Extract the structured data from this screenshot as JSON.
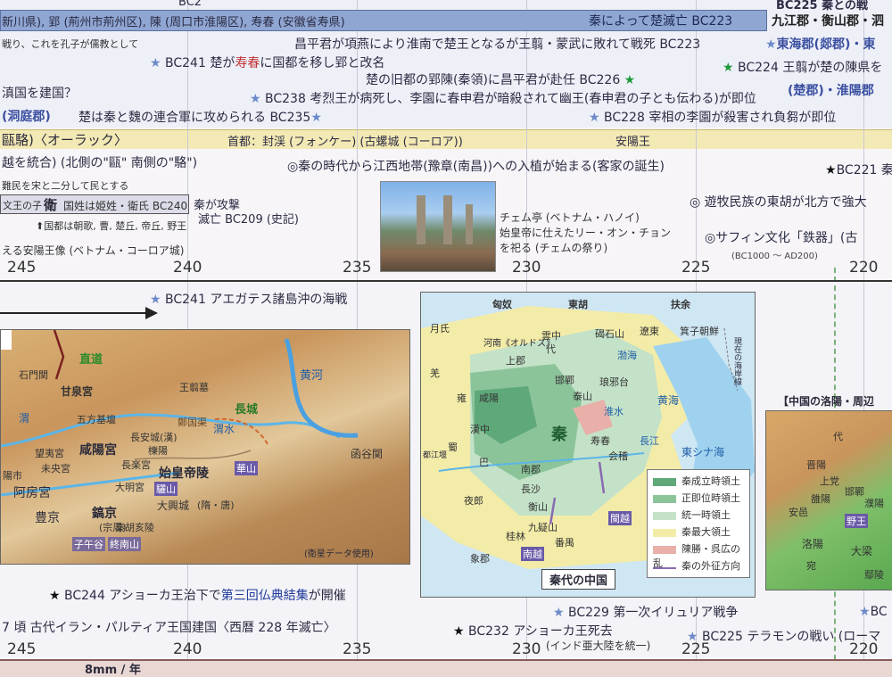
{
  "top": {
    "row0_left": "BC2",
    "row0_right": "BC225 秦との戦",
    "row1_left": "新川県), 郢 (荊州市荊州区), 陳 (周口市淮陽区), 寿春 (安徽省寿県)",
    "row1_bar": "秦によって楚滅亡 BC223",
    "row1_right": "九江郡・衡山郡・泗",
    "row2_left": "戦り、これを孔子が儒教として",
    "row2_mid": "昌平君が項燕により淮南で楚王となるが王翦・蒙武に敗れて戦死 BC223",
    "row2_right": "東海郡(郯郡)・東",
    "row3_a": "BC241 楚が",
    "row3_a_red": "寿春",
    "row3_a_tail": "に国都を移し郢と改名",
    "row3_right": "BC224 王翦が楚の陳県を",
    "row4_left": "滇国を建国？",
    "row4_mid": "楚の旧都の郢陳(秦領)に昌平君が赴任 BC226",
    "row4_right": "(楚郡)・淮陽郡",
    "row5_left": "(洞庭郡)",
    "row5_mid": "BC238 考烈王が病死し、李園に春申君が暗殺されて幽王(春申君の子とも伝わる)が即位",
    "row6_left": "楚は秦と魏の連合軍に攻められる BC235",
    "row6_right": "BC228 宰相の李園が殺害され負芻が即位"
  },
  "band": {
    "left": "甌駱)〈オーラック〉",
    "mid": "首都：封渓 (フォンケー) (古螺城 (コーロア))",
    "right": "安陽王"
  },
  "lower": {
    "l1": "越を統合) (北側の\"甌\" 南側の\"駱\")",
    "l1_mid": "◎秦の時代から江西地帯(豫章(南昌))への入植が始まる(客家の誕生)",
    "l1_right": "BC221 秦",
    "l2": "難民を宋と二分して民とする",
    "l2_right": "◎ 遊牧民族の東胡が北方で強大",
    "box_label": "文王の子",
    "box_big": "衛",
    "box_text": "国姓は姫姓・衛氏 BC240",
    "wei_note1": "秦が攻撃",
    "wei_note2": "滅亡 BC209 (史記)",
    "wei_arrow": "⬆国都は朝歌, 曹, 楚丘, 帝丘, 野王",
    "l4_right": "◎サフィン文化「鉄器」(古",
    "l4_right_sub": "(BC1000 ～ AD200)",
    "l5_left": "える安陽王像 (ベトナム・コーロア城)",
    "photo_cap1": "チェム亭 (ベトナム・ハノイ)",
    "photo_cap2": "始皇帝に仕えたリー・オン・チョン",
    "photo_cap3": "を祀る (チェムの祭り)"
  },
  "years": [
    "245",
    "240",
    "235",
    "230",
    "225",
    "220"
  ],
  "bottom": {
    "naval": "BC241 アエガテス諸島沖の海戦",
    "ashoka1_pre": "BC244 アショーカ王治下で",
    "ashoka1_hl": "第三回仏典結集",
    "ashoka1_tail": "が開催",
    "parthia": "7 頃 古代イラン・パルティア王国建国〈西暦 228 年滅亡〉",
    "ashoka2": "BC232 アショーカ王死去",
    "ashoka2_sub": "(インド亜大陸を統一)",
    "illyria": "BC229 第一次イリュリア戦争",
    "telamon": "BC225 テラモンの戦い (ローマ",
    "right_edge": "BC",
    "ruler": "8mm / 年"
  },
  "map_left": {
    "labels": [
      "直道",
      "石門関",
      "甘泉宮",
      "王翦墓",
      "五方基壇",
      "鄭国渠",
      "長城",
      "黄河",
      "渭水",
      "長安城(漢)",
      "櫟陽",
      "咸陽宮",
      "始皇帝陵",
      "望夷宮",
      "未央宮",
      "長楽宮",
      "大明宮",
      "阿房宮",
      "豊京",
      "鎬京",
      "(宗周)",
      "秦胡亥陵",
      "驪山",
      "華山",
      "大興城",
      "(隋・唐)",
      "子午谷",
      "終南山",
      "函谷関",
      "(衛星データ使用)",
      "陽市",
      "渭"
    ]
  },
  "map_mid": {
    "title": "秦代の中国",
    "labels": [
      "匈奴",
      "東胡",
      "扶余",
      "月氏",
      "雲中",
      "代",
      "羌",
      "河南《オルドス》",
      "上郡",
      "邯鄲",
      "遼東",
      "箕子朝鮮",
      "咸陽",
      "雍",
      "漢中",
      "巴",
      "蜀",
      "秦",
      "南郡",
      "長沙",
      "閩越",
      "南越",
      "夜郎",
      "桂林",
      "象郡",
      "番禺",
      "黄海",
      "東シナ海",
      "渤海",
      "長江",
      "淮水",
      "現在の海岸線",
      "都江堰",
      "寿春",
      "会稽",
      "九疑山",
      "衡山",
      "泰山",
      "琅邪台",
      "碣石山"
    ],
    "legend": [
      "秦成立時領土",
      "正即位時領土",
      "統一時領土",
      "秦最大領土",
      "陳勝・呉広の乱",
      "秦の外征方向"
    ],
    "legend_colors": [
      "#5fa87a",
      "#8cc49a",
      "#c4e2c8",
      "#f3eca8",
      "#e8b0a8",
      "#8a6ab0"
    ]
  },
  "map_right": {
    "title": "【中国の洛陽・周辺",
    "labels": [
      "代",
      "晋陽",
      "上党",
      "安邑",
      "邯鄲",
      "濮陽",
      "雒陽",
      "洛陽",
      "大梁",
      "宛",
      "野王",
      "鄢陵"
    ]
  }
}
